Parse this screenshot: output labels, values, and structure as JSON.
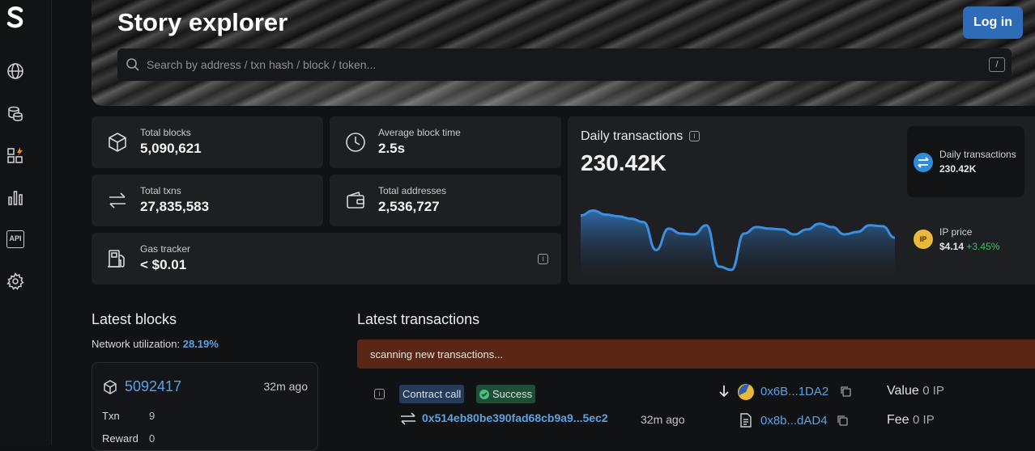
{
  "app": {
    "title": "Story explorer",
    "login_label": "Log in"
  },
  "search": {
    "placeholder": "Search by address / txn hash / block / token...",
    "shortcut": "/"
  },
  "sidebar": {
    "icons": [
      "logo-icon",
      "globe-icon",
      "coins-icon",
      "apps-icon",
      "chart-icon",
      "api-icon",
      "gear-icon"
    ],
    "api_label": "API"
  },
  "stats": {
    "total_blocks": {
      "label": "Total blocks",
      "value": "5,090,621"
    },
    "avg_block_time": {
      "label": "Average block time",
      "value": "2.5s"
    },
    "total_txns": {
      "label": "Total txns",
      "value": "27,835,583"
    },
    "total_addresses": {
      "label": "Total addresses",
      "value": "2,536,727"
    },
    "gas_tracker": {
      "label": "Gas tracker",
      "value": "< $0.01"
    }
  },
  "daily_transactions": {
    "title": "Daily transactions",
    "value": "230.42K",
    "side_label": "Daily transactions",
    "side_value": "230.42K",
    "ip_label": "IP price",
    "ip_value": "$4.14",
    "ip_change": "+3.45%",
    "ip_badge": "IP"
  },
  "chart_data": {
    "type": "area",
    "values": [
      0.72,
      0.78,
      0.73,
      0.71,
      0.68,
      0.64,
      0.3,
      0.56,
      0.5,
      0.49,
      0.6,
      0.1,
      0.06,
      0.5,
      0.58,
      0.56,
      0.55,
      0.49,
      0.55,
      0.62,
      0.58,
      0.49,
      0.52,
      0.6,
      0.59,
      0.45
    ],
    "colors": {
      "line": "#3b8fe0",
      "fill_top": "#2f6fb0",
      "fill_bottom": "#1e1f23"
    }
  },
  "latest_blocks": {
    "title": "Latest blocks",
    "util_label": "Network utilization:",
    "util_value": "28.19%",
    "block": {
      "number": "5092417",
      "age": "32m ago",
      "txn_label": "Txn",
      "txn_value": "9",
      "reward_label": "Reward",
      "reward_value": "0"
    }
  },
  "latest_transactions": {
    "title": "Latest transactions",
    "scanning": "scanning new transactions...",
    "tx": {
      "type": "Contract call",
      "status": "Success",
      "hash": "0x514eb80be390fad68cb9a9...5ec2",
      "age": "32m ago",
      "from": "0x6B...1DA2",
      "to": "0x8b...dAD4",
      "value_label": "Value",
      "value": "0 IP",
      "fee_label": "Fee",
      "fee": "0 IP"
    }
  }
}
